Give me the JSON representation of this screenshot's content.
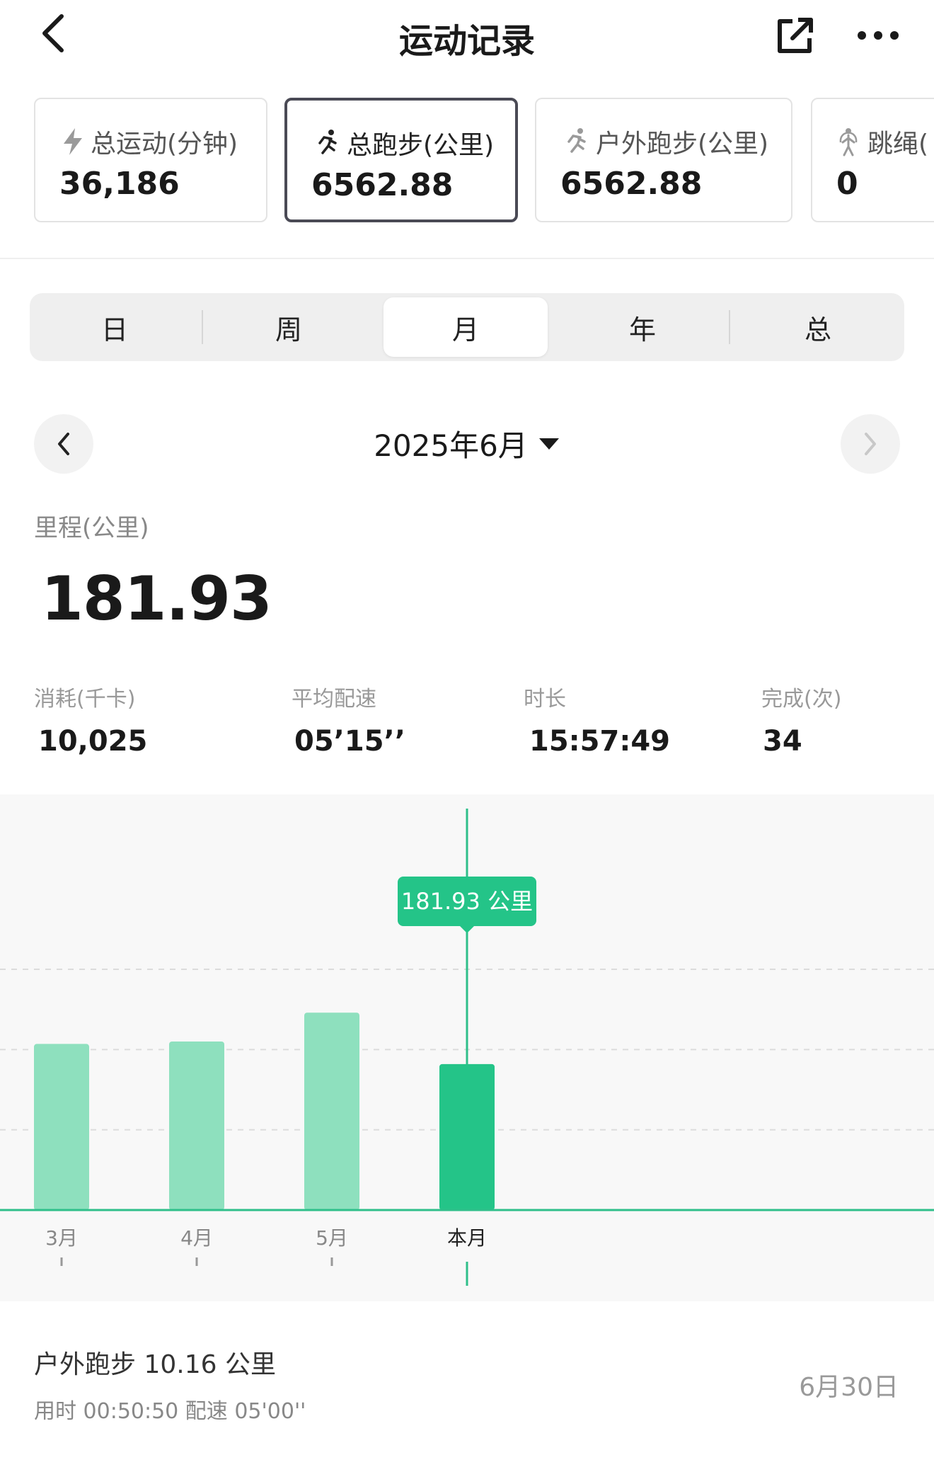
{
  "header": {
    "title": "运动记录",
    "back_icon": "chevron-left-icon",
    "share_icon": "share-icon",
    "more_icon": "more-icon"
  },
  "cards": [
    {
      "label": "总运动(分钟)",
      "value": "36,186",
      "icon": "lightning-icon"
    },
    {
      "label": "总跑步(公里)",
      "value": "6562.88",
      "icon": "running-icon",
      "active": true
    },
    {
      "label": "户外跑步(公里)",
      "value": "6562.88",
      "icon": "outdoor-running-icon"
    },
    {
      "label": "跳绳(",
      "value": "0",
      "icon": "jump-rope-icon"
    }
  ],
  "period_tabs": [
    "日",
    "周",
    "月",
    "年",
    "总"
  ],
  "selected_period": "月",
  "date_nav": {
    "title": "2025年6月"
  },
  "summary": {
    "distance_label": "里程(公里)",
    "distance_value": "181.93",
    "stats": [
      {
        "label": "消耗(千卡)",
        "value": "10,025"
      },
      {
        "label": "平均配速",
        "value": "05’15’’"
      },
      {
        "label": "时长",
        "value": "15:57:49"
      },
      {
        "label": "完成(次)",
        "value": "34"
      }
    ]
  },
  "chart_data": {
    "type": "bar",
    "categories": [
      "3月",
      "4月",
      "5月",
      "本月"
    ],
    "values": [
      207,
      210,
      246,
      181.93
    ],
    "ylim": [
      0,
      300
    ],
    "highlight_index": 3,
    "tooltip": "181.93 公里",
    "colors": {
      "bar": "#8EE0BE",
      "highlight": "#24C488",
      "axis": "#2FBF8A"
    },
    "grid": true
  },
  "record": {
    "title": "户外跑步  10.16 公里",
    "sub": "用时 00:50:50    配速 05'00''",
    "date": "6月30日"
  }
}
